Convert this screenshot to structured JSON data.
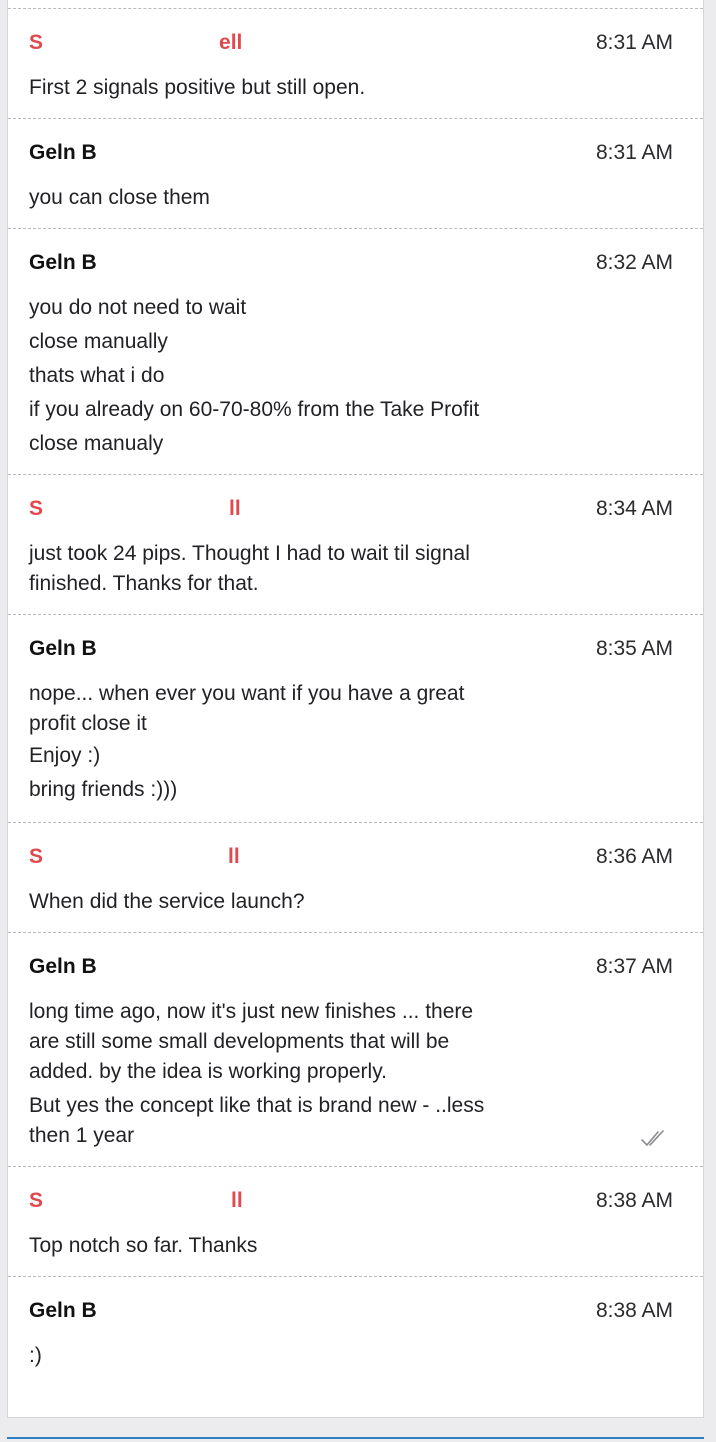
{
  "messages": [
    {
      "sender_left": "S",
      "sender_right": "ell",
      "sender_color": "#e04a4f",
      "time": "8:31 AM",
      "lines": [
        "First 2 signals positive but still open."
      ]
    },
    {
      "sender": "Geln B",
      "time": "8:31 AM",
      "lines": [
        "you can close them"
      ]
    },
    {
      "sender": "Geln B",
      "time": "8:32 AM",
      "lines": [
        "you do not need to wait",
        "close manually",
        "thats what i do",
        "if you already on 60-70-80% from the Take Profit",
        "close manualy"
      ]
    },
    {
      "sender_left": "S",
      "sender_right": "ll",
      "sender_color": "#e04a4f",
      "time": "8:34 AM",
      "lines": [
        "just took 24 pips. Thought I had to wait til signal",
        "finished. Thanks for that."
      ]
    },
    {
      "sender": "Geln B",
      "time": "8:35 AM",
      "lines": [
        "nope... when ever you want if you have a great",
        "profit close it",
        "Enjoy :)",
        "bring friends :)))"
      ]
    },
    {
      "sender_left": "S",
      "sender_right": "ll",
      "sender_color": "#e04a4f",
      "time": "8:36 AM",
      "lines": [
        "When did the service launch?"
      ]
    },
    {
      "sender": "Geln B",
      "time": "8:37 AM",
      "lines": [
        "long time ago, now it's just new finishes ... there",
        "are still some small developments that will be",
        "added. by the idea is working properly.",
        "But yes the concept like that is brand new - ..less",
        "then 1 year"
      ],
      "read_icon": "double-check-icon"
    },
    {
      "sender_left": "S",
      "sender_right": "ll",
      "sender_color": "#e04a4f",
      "time": "8:38 AM",
      "lines": [
        "Top notch so far. Thanks"
      ]
    },
    {
      "sender": "Geln B",
      "time": "8:38 AM",
      "lines": [
        ":)"
      ]
    }
  ]
}
